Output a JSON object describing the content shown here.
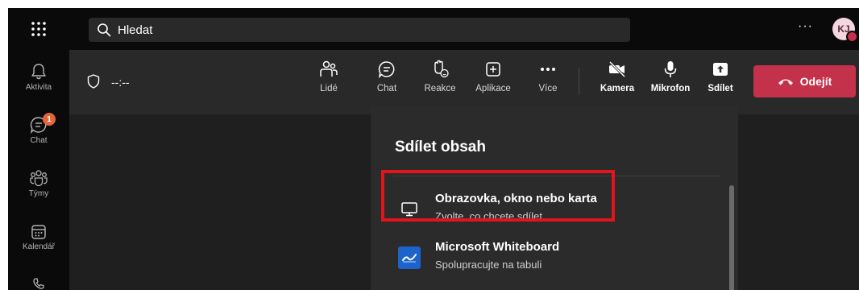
{
  "search": {
    "placeholder": "Hledat"
  },
  "topbar": {
    "more": "···",
    "avatar_initials": "KJ"
  },
  "rail": {
    "items": [
      {
        "label": "Aktivita",
        "icon": "bell-icon"
      },
      {
        "label": "Chat",
        "icon": "chat-icon",
        "badge": "1"
      },
      {
        "label": "Týmy",
        "icon": "teams-icon"
      },
      {
        "label": "Kalendář",
        "icon": "calendar-icon"
      }
    ]
  },
  "meeting": {
    "timer": "--:--",
    "buttons": [
      {
        "label": "Lidé",
        "icon": "people-icon"
      },
      {
        "label": "Chat",
        "icon": "chat-icon"
      },
      {
        "label": "Reakce",
        "icon": "raise-hand-icon"
      },
      {
        "label": "Aplikace",
        "icon": "apps-icon"
      },
      {
        "label": "Více",
        "icon": "more-icon"
      },
      {
        "label": "Kamera",
        "icon": "camera-off-icon"
      },
      {
        "label": "Mikrofon",
        "icon": "microphone-icon"
      },
      {
        "label": "Sdílet",
        "icon": "share-icon"
      }
    ],
    "leave_label": "Odejít"
  },
  "share_panel": {
    "title": "Sdílet obsah",
    "options": [
      {
        "title": "Obrazovka, okno nebo karta",
        "subtitle": "Zvolte, co chcete sdílet.",
        "icon": "monitor-icon"
      },
      {
        "title": "Microsoft Whiteboard",
        "subtitle": "Spolupracujte na tabuli",
        "icon": "whiteboard-icon"
      }
    ]
  },
  "colors": {
    "leave": "#c4314b",
    "accent": "#7f85f5",
    "highlight": "#e3141b",
    "badge": "#e3653c"
  }
}
